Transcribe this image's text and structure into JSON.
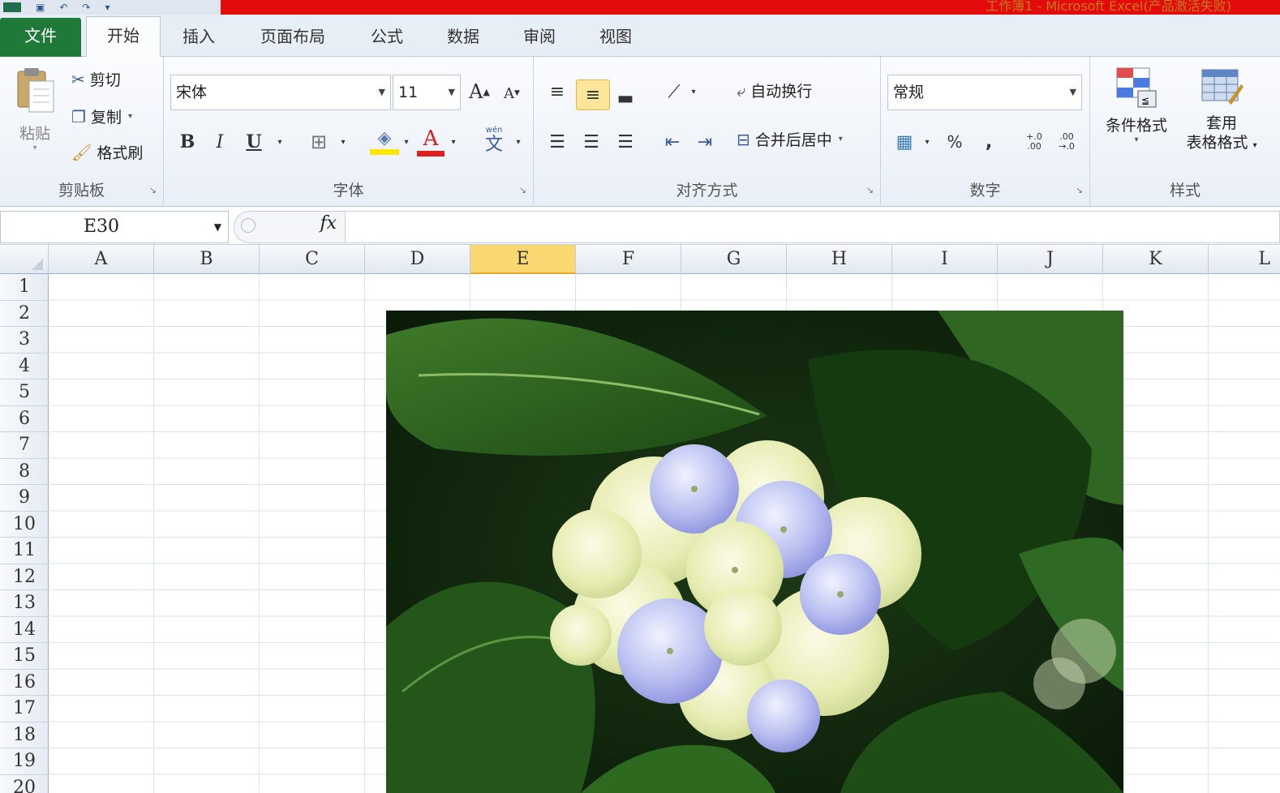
{
  "window": {
    "title": "工作簿1 - Microsoft Excel(产品激活失败)",
    "quick_access": [
      "x-logo-icon",
      "save-icon",
      "undo-icon",
      "redo-icon",
      "customize-icon"
    ]
  },
  "tabs": {
    "file": "文件",
    "items": [
      "开始",
      "插入",
      "页面布局",
      "公式",
      "数据",
      "审阅",
      "视图"
    ],
    "active": "开始"
  },
  "ribbon": {
    "clipboard": {
      "label": "剪贴板",
      "paste": "粘贴",
      "cut": "剪切",
      "copy": "复制",
      "format_painter": "格式刷"
    },
    "font": {
      "label": "字体",
      "font_name": "宋体",
      "font_size": "11",
      "grow": "A",
      "shrink": "A",
      "bold": "B",
      "italic": "I",
      "underline": "U",
      "font_color": "A",
      "highlight_color": "#ffe800",
      "font_color_value": "#e02020",
      "phonetic": "wén"
    },
    "alignment": {
      "label": "对齐方式",
      "wrap_text": "自动换行",
      "merge_center": "合并后居中"
    },
    "number": {
      "label": "数字",
      "format": "常规",
      "percent": "%",
      "comma": ",",
      "inc_decimal": "+.0 .00",
      "dec_decimal": ".00 →.0"
    },
    "styles": {
      "label": "样式",
      "conditional": "条件格式",
      "table_line1": "套用",
      "table_line2": "表格格式"
    }
  },
  "formula_bar": {
    "name_box": "E30",
    "fx": "fx",
    "content": ""
  },
  "sheet": {
    "columns": [
      "A",
      "B",
      "C",
      "D",
      "E",
      "F",
      "G",
      "H",
      "I",
      "J",
      "K",
      "L"
    ],
    "selected_column": "E",
    "rows": [
      "1",
      "2",
      "3",
      "4",
      "5",
      "6",
      "7",
      "8",
      "9",
      "10",
      "11",
      "12",
      "13",
      "14",
      "15",
      "16",
      "17",
      "18",
      "19",
      "20"
    ]
  },
  "picture": {
    "subject": "hydrangea-photo"
  }
}
